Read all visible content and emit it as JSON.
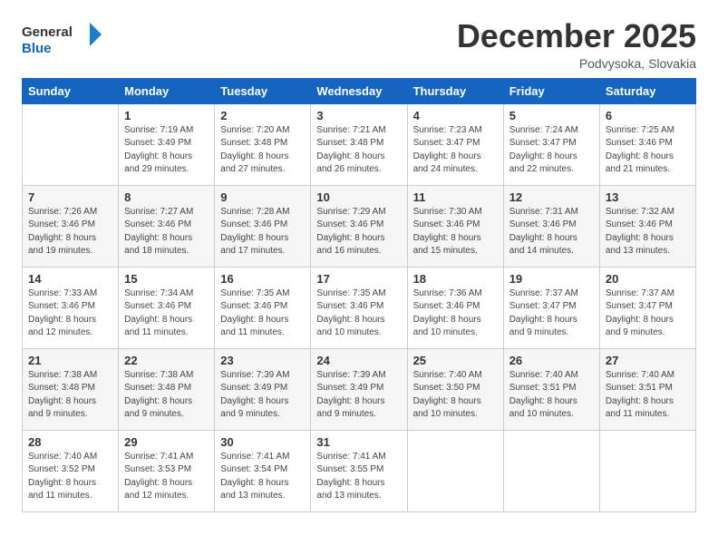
{
  "header": {
    "logo_general": "General",
    "logo_blue": "Blue",
    "month_title": "December 2025",
    "location": "Podvysoka, Slovakia"
  },
  "columns": [
    "Sunday",
    "Monday",
    "Tuesday",
    "Wednesday",
    "Thursday",
    "Friday",
    "Saturday"
  ],
  "weeks": [
    [
      {
        "day": "",
        "info": ""
      },
      {
        "day": "1",
        "info": "Sunrise: 7:19 AM\nSunset: 3:49 PM\nDaylight: 8 hours\nand 29 minutes."
      },
      {
        "day": "2",
        "info": "Sunrise: 7:20 AM\nSunset: 3:48 PM\nDaylight: 8 hours\nand 27 minutes."
      },
      {
        "day": "3",
        "info": "Sunrise: 7:21 AM\nSunset: 3:48 PM\nDaylight: 8 hours\nand 26 minutes."
      },
      {
        "day": "4",
        "info": "Sunrise: 7:23 AM\nSunset: 3:47 PM\nDaylight: 8 hours\nand 24 minutes."
      },
      {
        "day": "5",
        "info": "Sunrise: 7:24 AM\nSunset: 3:47 PM\nDaylight: 8 hours\nand 22 minutes."
      },
      {
        "day": "6",
        "info": "Sunrise: 7:25 AM\nSunset: 3:46 PM\nDaylight: 8 hours\nand 21 minutes."
      }
    ],
    [
      {
        "day": "7",
        "info": "Sunrise: 7:26 AM\nSunset: 3:46 PM\nDaylight: 8 hours\nand 19 minutes."
      },
      {
        "day": "8",
        "info": "Sunrise: 7:27 AM\nSunset: 3:46 PM\nDaylight: 8 hours\nand 18 minutes."
      },
      {
        "day": "9",
        "info": "Sunrise: 7:28 AM\nSunset: 3:46 PM\nDaylight: 8 hours\nand 17 minutes."
      },
      {
        "day": "10",
        "info": "Sunrise: 7:29 AM\nSunset: 3:46 PM\nDaylight: 8 hours\nand 16 minutes."
      },
      {
        "day": "11",
        "info": "Sunrise: 7:30 AM\nSunset: 3:46 PM\nDaylight: 8 hours\nand 15 minutes."
      },
      {
        "day": "12",
        "info": "Sunrise: 7:31 AM\nSunset: 3:46 PM\nDaylight: 8 hours\nand 14 minutes."
      },
      {
        "day": "13",
        "info": "Sunrise: 7:32 AM\nSunset: 3:46 PM\nDaylight: 8 hours\nand 13 minutes."
      }
    ],
    [
      {
        "day": "14",
        "info": "Sunrise: 7:33 AM\nSunset: 3:46 PM\nDaylight: 8 hours\nand 12 minutes."
      },
      {
        "day": "15",
        "info": "Sunrise: 7:34 AM\nSunset: 3:46 PM\nDaylight: 8 hours\nand 11 minutes."
      },
      {
        "day": "16",
        "info": "Sunrise: 7:35 AM\nSunset: 3:46 PM\nDaylight: 8 hours\nand 11 minutes."
      },
      {
        "day": "17",
        "info": "Sunrise: 7:35 AM\nSunset: 3:46 PM\nDaylight: 8 hours\nand 10 minutes."
      },
      {
        "day": "18",
        "info": "Sunrise: 7:36 AM\nSunset: 3:46 PM\nDaylight: 8 hours\nand 10 minutes."
      },
      {
        "day": "19",
        "info": "Sunrise: 7:37 AM\nSunset: 3:47 PM\nDaylight: 8 hours\nand 9 minutes."
      },
      {
        "day": "20",
        "info": "Sunrise: 7:37 AM\nSunset: 3:47 PM\nDaylight: 8 hours\nand 9 minutes."
      }
    ],
    [
      {
        "day": "21",
        "info": "Sunrise: 7:38 AM\nSunset: 3:48 PM\nDaylight: 8 hours\nand 9 minutes."
      },
      {
        "day": "22",
        "info": "Sunrise: 7:38 AM\nSunset: 3:48 PM\nDaylight: 8 hours\nand 9 minutes."
      },
      {
        "day": "23",
        "info": "Sunrise: 7:39 AM\nSunset: 3:49 PM\nDaylight: 8 hours\nand 9 minutes."
      },
      {
        "day": "24",
        "info": "Sunrise: 7:39 AM\nSunset: 3:49 PM\nDaylight: 8 hours\nand 9 minutes."
      },
      {
        "day": "25",
        "info": "Sunrise: 7:40 AM\nSunset: 3:50 PM\nDaylight: 8 hours\nand 10 minutes."
      },
      {
        "day": "26",
        "info": "Sunrise: 7:40 AM\nSunset: 3:51 PM\nDaylight: 8 hours\nand 10 minutes."
      },
      {
        "day": "27",
        "info": "Sunrise: 7:40 AM\nSunset: 3:51 PM\nDaylight: 8 hours\nand 11 minutes."
      }
    ],
    [
      {
        "day": "28",
        "info": "Sunrise: 7:40 AM\nSunset: 3:52 PM\nDaylight: 8 hours\nand 11 minutes."
      },
      {
        "day": "29",
        "info": "Sunrise: 7:41 AM\nSunset: 3:53 PM\nDaylight: 8 hours\nand 12 minutes."
      },
      {
        "day": "30",
        "info": "Sunrise: 7:41 AM\nSunset: 3:54 PM\nDaylight: 8 hours\nand 13 minutes."
      },
      {
        "day": "31",
        "info": "Sunrise: 7:41 AM\nSunset: 3:55 PM\nDaylight: 8 hours\nand 13 minutes."
      },
      {
        "day": "",
        "info": ""
      },
      {
        "day": "",
        "info": ""
      },
      {
        "day": "",
        "info": ""
      }
    ]
  ]
}
